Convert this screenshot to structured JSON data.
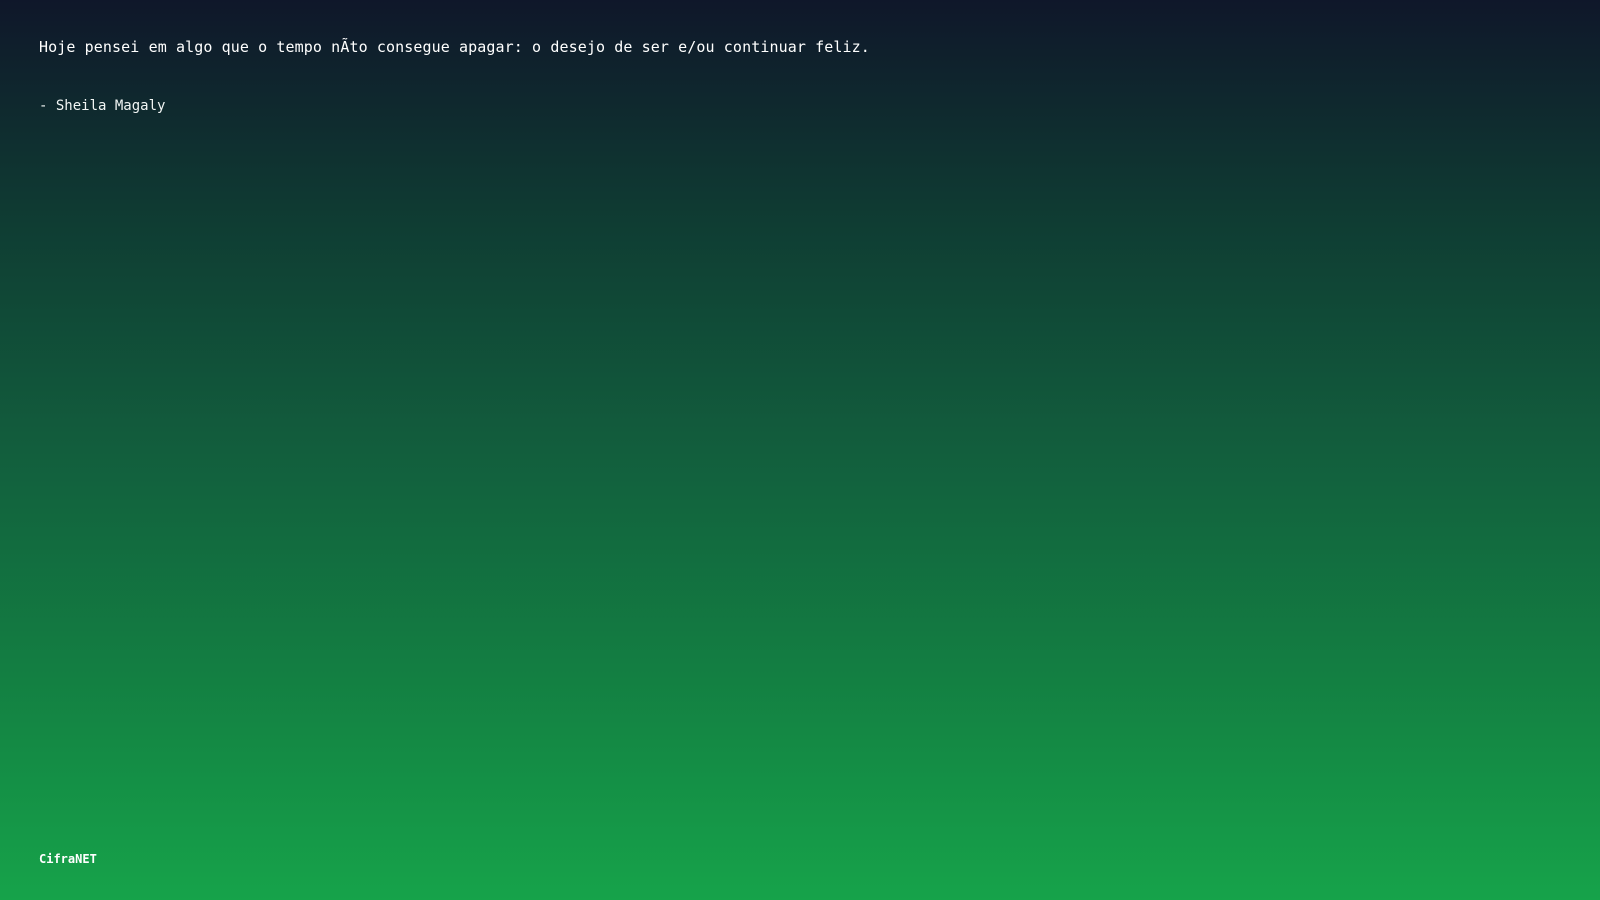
{
  "quote": {
    "text": "Hoje pensei em algo que o tempo nÃto consegue apagar: o desejo de ser e/ou continuar feliz.",
    "author": "- Sheila Magaly"
  },
  "footer": {
    "brand": "CifraNET"
  },
  "colors": {
    "gradient_top": "#0f172a",
    "gradient_bottom": "#16a34a",
    "text": "#ffffff"
  }
}
